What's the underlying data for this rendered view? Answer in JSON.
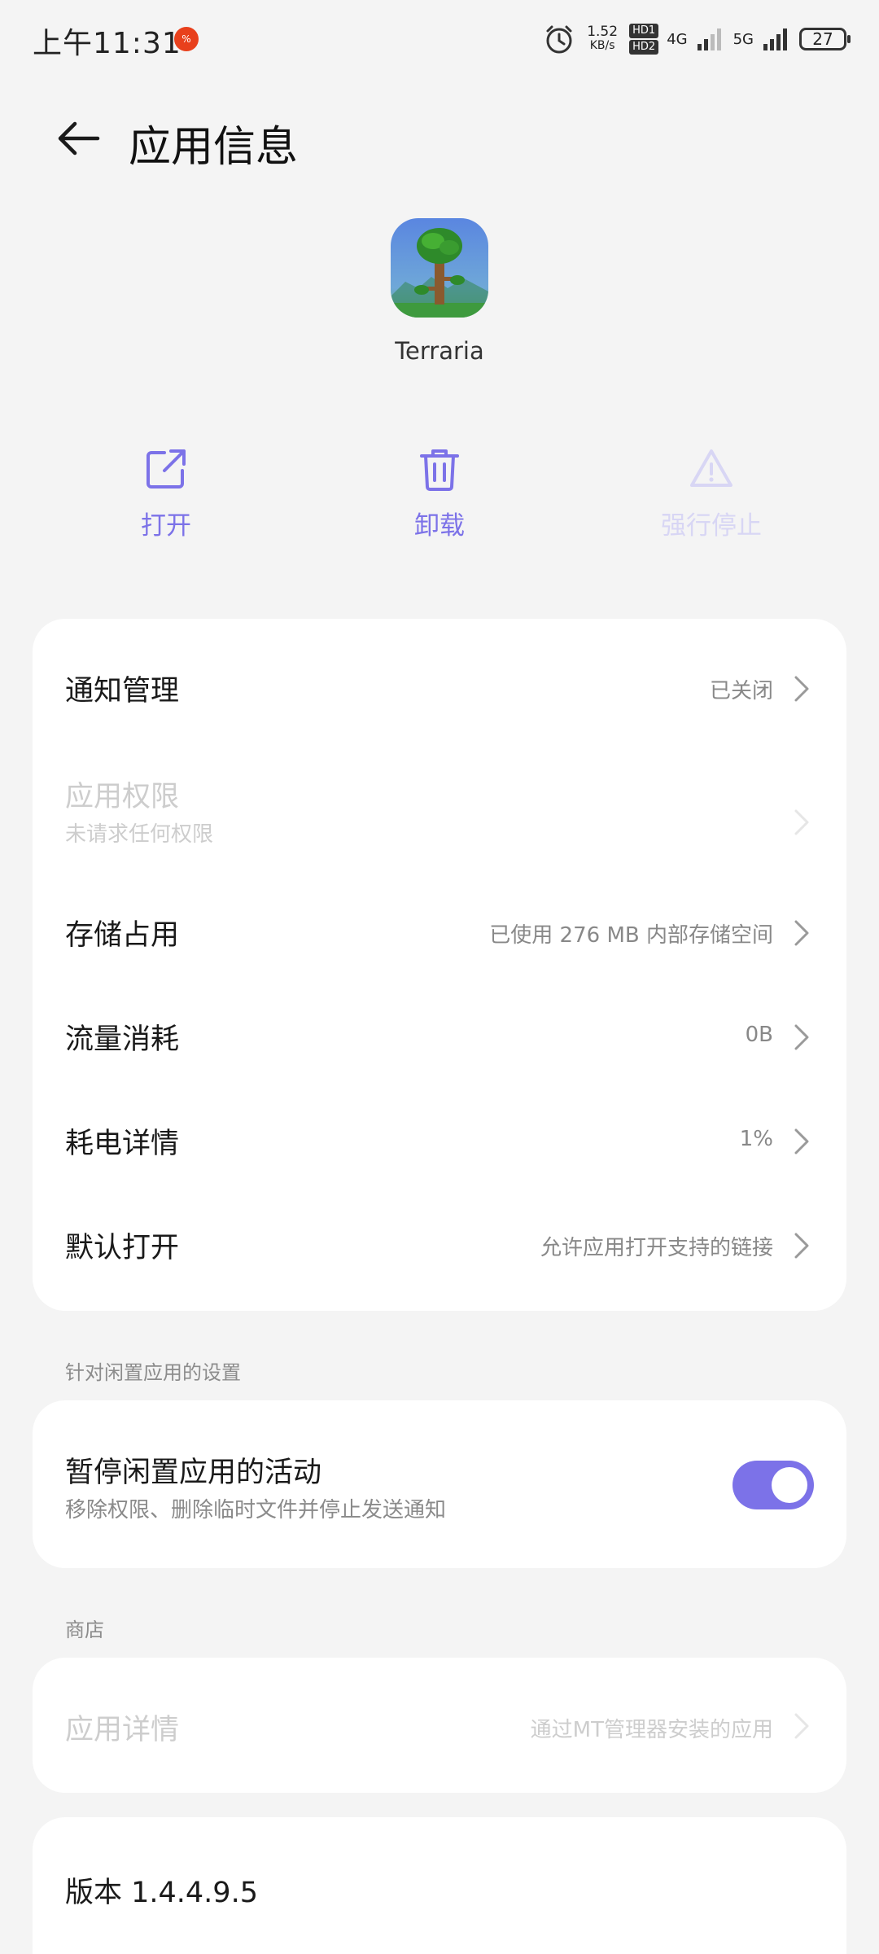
{
  "status_bar": {
    "time": "上午11:31",
    "notif_badge": "%",
    "speed_value": "1.52",
    "speed_unit": "KB/s",
    "hd1": "HD1",
    "hd2": "HD2",
    "net1": "4G",
    "net2": "5G",
    "battery": "27"
  },
  "header": {
    "title": "应用信息"
  },
  "app": {
    "name": "Terraria"
  },
  "actions": {
    "open": "打开",
    "uninstall": "卸载",
    "force_stop": "强行停止"
  },
  "settings": {
    "notification": {
      "title": "通知管理",
      "value": "已关闭"
    },
    "permissions": {
      "title": "应用权限",
      "subtitle": "未请求任何权限"
    },
    "storage": {
      "title": "存储占用",
      "value": "已使用 276 MB 内部存储空间"
    },
    "data_usage": {
      "title": "流量消耗",
      "value": "0B"
    },
    "battery": {
      "title": "耗电详情",
      "value": "1%"
    },
    "default_open": {
      "title": "默认打开",
      "value": "允许应用打开支持的链接"
    }
  },
  "idle_section": {
    "label": "针对闲置应用的设置",
    "pause": {
      "title": "暂停闲置应用的活动",
      "subtitle": "移除权限、删除临时文件并停止发送通知",
      "enabled": true
    }
  },
  "store_section": {
    "label": "商店",
    "details": {
      "title": "应用详情",
      "value": "通过MT管理器安装的应用"
    }
  },
  "version": {
    "text": "版本 1.4.4.9.5"
  },
  "colors": {
    "accent": "#7c72e8",
    "accent_disabled": "#d8d6f4",
    "background": "#f4f4f4",
    "card": "#ffffff"
  }
}
